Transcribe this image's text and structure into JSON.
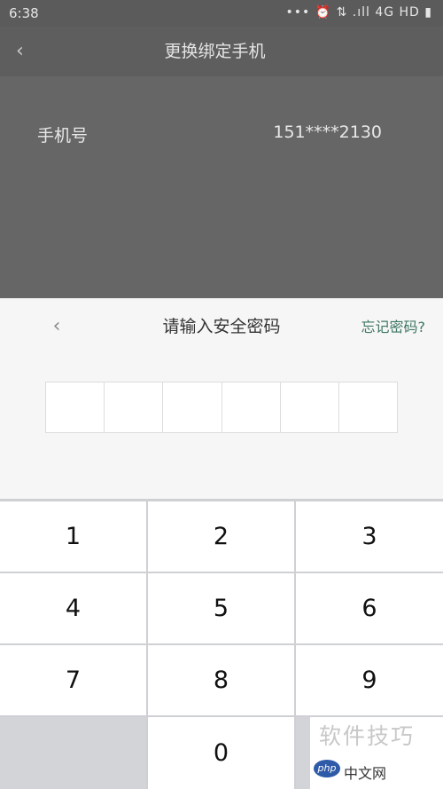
{
  "status_bar": {
    "time": "6:38",
    "icons_text": "••• ⏰ ⇅ .ıll 4G HD ▮"
  },
  "header": {
    "back_icon": "chevron-left-icon",
    "title": "更换绑定手机"
  },
  "phone_row": {
    "label": "手机号",
    "value": "151****2130"
  },
  "password_panel": {
    "back_icon": "chevron-left-icon",
    "title": "请输入安全密码",
    "forgot_label": "忘记密码?",
    "digit_slots": 6
  },
  "keypad": {
    "keys": [
      "1",
      "2",
      "3",
      "4",
      "5",
      "6",
      "7",
      "8",
      "9",
      "",
      "0",
      ""
    ]
  },
  "watermark": {
    "text": "软件技巧",
    "site": "中文网",
    "logo": "php"
  },
  "colors": {
    "overlay": "#5e5e5e",
    "accent": "#3e7764",
    "keypad_bg": "#cfd0d4"
  }
}
